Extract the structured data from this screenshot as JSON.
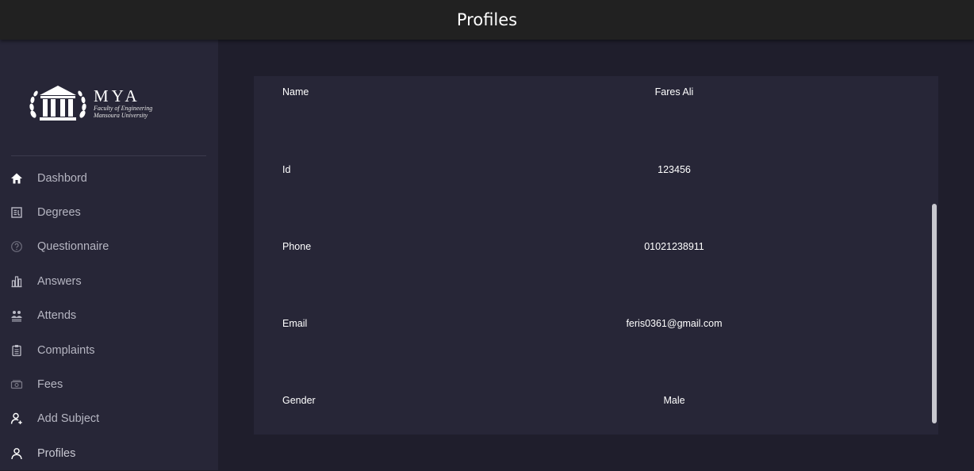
{
  "header": {
    "title": "Profiles"
  },
  "logo": {
    "brand": "MYA",
    "line1": "Faculty of Engineering",
    "line2": "Mansoura University"
  },
  "sidebar": {
    "items": [
      {
        "label": "Dashbord",
        "icon": "home-icon"
      },
      {
        "label": "Degrees",
        "icon": "grades-icon"
      },
      {
        "label": "Questionnaire",
        "icon": "help-circle-icon"
      },
      {
        "label": "Answers",
        "icon": "bar-chart-icon"
      },
      {
        "label": "Attends",
        "icon": "people-icon"
      },
      {
        "label": "Complaints",
        "icon": "clipboard-icon"
      },
      {
        "label": "Fees",
        "icon": "money-icon"
      },
      {
        "label": "Add Subject",
        "icon": "add-person-icon"
      },
      {
        "label": "Profiles",
        "icon": "person-icon"
      }
    ]
  },
  "profile": {
    "rows": [
      {
        "label": "Name",
        "value": "Fares Ali"
      },
      {
        "label": "Id",
        "value": "123456"
      },
      {
        "label": "Phone",
        "value": "01021238911"
      },
      {
        "label": "Email",
        "value": "feris0361@gmail.com"
      },
      {
        "label": "Gender",
        "value": "Male"
      }
    ]
  }
}
